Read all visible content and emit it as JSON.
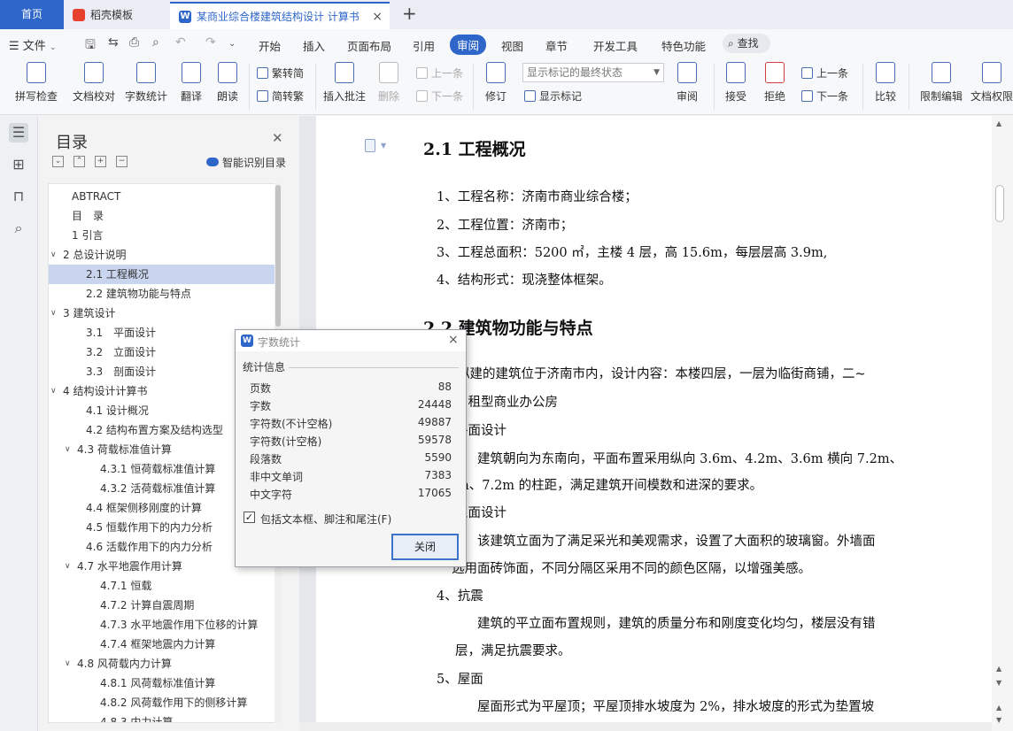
{
  "tabs": {
    "home": "首页",
    "templates": "稻壳模板",
    "document": "某商业综合楼建筑结构设计 计算书",
    "close_glyph": "×",
    "add_glyph": "+"
  },
  "menu": {
    "file": "文件",
    "items": [
      "开始",
      "插入",
      "页面布局",
      "引用",
      "审阅",
      "视图",
      "章节",
      "开发工具",
      "特色功能"
    ],
    "active": "审阅",
    "search": "查找"
  },
  "ribbon": {
    "spell_check": "拼写检查",
    "doc_proof": "文档校对",
    "word_count": "字数统计",
    "translate": "翻译",
    "read_aloud": "朗读",
    "trad_to_simp": "繁转简",
    "simp_to_trad": "简转繁",
    "insert_comment": "插入批注",
    "delete": "删除",
    "prev_comment": "上一条",
    "next_comment": "下一条",
    "revise": "修订",
    "markup_state": "显示标记的最终状态",
    "show_markup": "显示标记",
    "review": "审阅",
    "accept": "接受",
    "reject": "拒绝",
    "prev_change": "上一条",
    "next_change": "下一条",
    "compare": "比较",
    "restrict_edit": "限制编辑",
    "doc_permission": "文档权限"
  },
  "outline": {
    "title": "目录",
    "smart_toc": "智能识别目录",
    "items": [
      {
        "text": "ABTRACT",
        "level": 0
      },
      {
        "text": "目　录",
        "level": 0
      },
      {
        "text": "1 引言",
        "level": 0
      },
      {
        "text": "2 总设计说明",
        "level": 0,
        "expanded": true
      },
      {
        "text": "2.1 工程概况",
        "level": 1,
        "selected": true
      },
      {
        "text": "2.2 建筑物功能与特点",
        "level": 1
      },
      {
        "text": "3 建筑设计",
        "level": 0,
        "expanded": true
      },
      {
        "text": "3.1　平面设计",
        "level": 1
      },
      {
        "text": "3.2　立面设计",
        "level": 1
      },
      {
        "text": "3.3　剖面设计",
        "level": 1
      },
      {
        "text": "4 结构设计计算书",
        "level": 0,
        "expanded": true
      },
      {
        "text": "4.1 设计概况",
        "level": 1
      },
      {
        "text": "4.2 结构布置方案及结构选型",
        "level": 1
      },
      {
        "text": "4.3 荷载标准值计算",
        "level": 1,
        "expanded": true
      },
      {
        "text": "4.3.1 恒荷载标准值计算",
        "level": 2
      },
      {
        "text": "4.3.2 活荷载标准值计算",
        "level": 2
      },
      {
        "text": "4.4 框架侧移刚度的计算",
        "level": 1
      },
      {
        "text": "4.5 恒载作用下的内力分析",
        "level": 1
      },
      {
        "text": "4.6 活载作用下的内力分析",
        "level": 1
      },
      {
        "text": "4.7 水平地震作用计算",
        "level": 1,
        "expanded": true
      },
      {
        "text": "4.7.1 恒载",
        "level": 2
      },
      {
        "text": "4.7.2 计算自震周期",
        "level": 2
      },
      {
        "text": "4.7.3 水平地震作用下位移的计算",
        "level": 2
      },
      {
        "text": "4.7.4 框架地震内力计算",
        "level": 2
      },
      {
        "text": "4.8 风荷载内力计算",
        "level": 1,
        "expanded": true
      },
      {
        "text": "4.8.1 风荷载标准值计算",
        "level": 2
      },
      {
        "text": "4.8.2 风荷载作用下的侧移计算",
        "level": 2
      },
      {
        "text": "4.8.3 内力计算",
        "level": 2
      }
    ]
  },
  "document": {
    "h1": "2.1 工程概况",
    "p1": "1、工程名称：济南市商业综合楼；",
    "p2": "2、工程位置：济南市；",
    "p3": "3、工程总面积：5200 ㎡，主楼 4 层，高 15.6m，每层层高 3.9m,",
    "p4": "4、结构形式：现浇整体框架。",
    "h2": "2.2 建筑物功能与特点",
    "p5a": "拟建的建筑位于济南市内，设计内容：本楼四层，一层为临街商铺，二~",
    "p5b": "出租型商业办公房",
    "s1": "平面设计",
    "p6a": "建筑朝向为东南向，平面布置采用纵向 3.6m、4.2m、3.6m 横向 7.2m、",
    "p6b": "m、7.2m 的柱距，满足建筑开间模数和进深的要求。",
    "s2": "立面设计",
    "p7a": "该建筑立面为了满足采光和美观需求，设置了大面积的玻璃窗。外墙面",
    "p7b": "选用面砖饰面，不同分隔区采用不同的颜色区隔，以增强美感。",
    "s3": "4、抗震",
    "p8a": "建筑的平立面布置规则，建筑的质量分布和刚度变化均匀，楼层没有错",
    "p8b": "层，满足抗震要求。",
    "s4": "5、屋面",
    "p9": "屋面形式为平屋顶；平屋顶排水坡度为 2%，排水坡度的形式为垫置坡"
  },
  "dialog": {
    "title": "字数统计",
    "section": "统计信息",
    "stats": [
      {
        "label": "页数",
        "value": "88"
      },
      {
        "label": "字数",
        "value": "24448"
      },
      {
        "label": "字符数(不计空格)",
        "value": "49887"
      },
      {
        "label": "字符数(计空格)",
        "value": "59578"
      },
      {
        "label": "段落数",
        "value": "5590"
      },
      {
        "label": "非中文单词",
        "value": "7383"
      },
      {
        "label": "中文字符",
        "value": "17065"
      }
    ],
    "checkbox_label": "包括文本框、脚注和尾注(F)",
    "checkbox_checked": true,
    "close_button": "关闭",
    "close_glyph": "×"
  }
}
